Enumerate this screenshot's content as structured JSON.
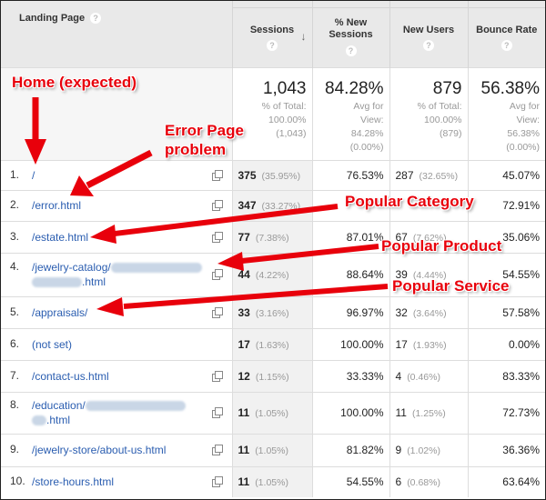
{
  "table": {
    "headers": {
      "landing_page": "Landing Page",
      "sessions": "Sessions",
      "pct_new_sessions": "% New Sessions",
      "new_users": "New Users",
      "bounce_rate": "Bounce Rate",
      "help": "?"
    },
    "summary": {
      "sessions": {
        "value": "1,043",
        "l1": "% of Total:",
        "l2": "100.00%",
        "l3": "(1,043)"
      },
      "pct_new": {
        "value": "84.28%",
        "l1": "Avg for",
        "l2": "View:",
        "l3": "84.28%",
        "l4": "(0.00%)"
      },
      "new_users": {
        "value": "879",
        "l1": "% of Total:",
        "l2": "100.00%",
        "l3": "(879)"
      },
      "bounce": {
        "value": "56.38%",
        "l1": "Avg for",
        "l2": "View:",
        "l3": "56.38%",
        "l4": "(0.00%)"
      }
    },
    "rows": [
      {
        "n": "1.",
        "page": "/",
        "sessions": "375",
        "spct": "(35.95%)",
        "pnew": "76.53%",
        "users": "287",
        "upct": "(32.65%)",
        "bounce": "45.07%"
      },
      {
        "n": "2.",
        "page": "/error.html",
        "sessions": "347",
        "spct": "(33.27%)",
        "pnew": "",
        "users": "",
        "upct": "",
        "bounce": "72.91%"
      },
      {
        "n": "3.",
        "page": "/estate.html",
        "sessions": "77",
        "spct": "(7.38%)",
        "pnew": "87.01%",
        "users": "67",
        "upct": "(7.62%)",
        "bounce": "35.06%"
      },
      {
        "n": "4.",
        "page": "/jewelry-catalog/",
        "page2": ".html",
        "sessions": "44",
        "spct": "(4.22%)",
        "pnew": "88.64%",
        "users": "39",
        "upct": "(4.44%)",
        "bounce": "54.55%"
      },
      {
        "n": "5.",
        "page": "/appraisals/",
        "sessions": "33",
        "spct": "(3.16%)",
        "pnew": "96.97%",
        "users": "32",
        "upct": "(3.64%)",
        "bounce": "57.58%"
      },
      {
        "n": "6.",
        "page": "(not set)",
        "sessions": "17",
        "spct": "(1.63%)",
        "pnew": "100.00%",
        "users": "17",
        "upct": "(1.93%)",
        "bounce": "0.00%"
      },
      {
        "n": "7.",
        "page": "/contact-us.html",
        "sessions": "12",
        "spct": "(1.15%)",
        "pnew": "33.33%",
        "users": "4",
        "upct": "(0.46%)",
        "bounce": "83.33%"
      },
      {
        "n": "8.",
        "page": "/education/",
        "page2": ".html",
        "sessions": "11",
        "spct": "(1.05%)",
        "pnew": "100.00%",
        "users": "11",
        "upct": "(1.25%)",
        "bounce": "72.73%"
      },
      {
        "n": "9.",
        "page": "/jewelry-store/about-us.html",
        "sessions": "11",
        "spct": "(1.05%)",
        "pnew": "81.82%",
        "users": "9",
        "upct": "(1.02%)",
        "bounce": "36.36%"
      },
      {
        "n": "10.",
        "page": "/store-hours.html",
        "sessions": "11",
        "spct": "(1.05%)",
        "pnew": "54.55%",
        "users": "6",
        "upct": "(0.68%)",
        "bounce": "63.64%"
      }
    ]
  },
  "annotations": {
    "home": "Home (expected)",
    "error1": "Error Page",
    "error2": "problem",
    "category": "Popular Category",
    "product": "Popular Product",
    "service": "Popular Service"
  },
  "colors": {
    "annotation": "#e8000b",
    "link": "#2a5db0"
  }
}
